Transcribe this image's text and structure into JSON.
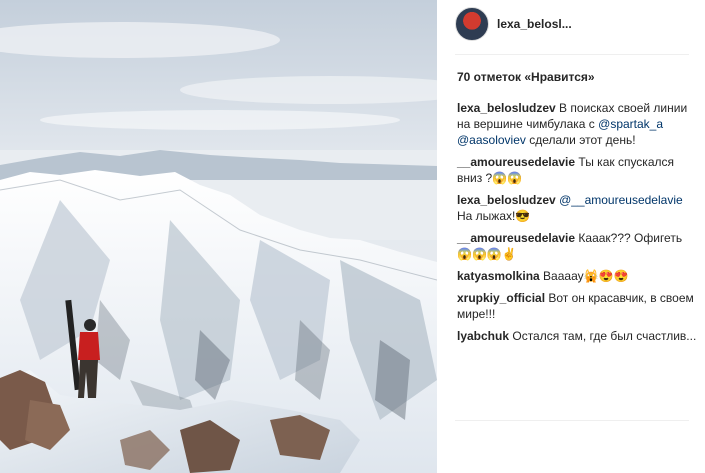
{
  "post": {
    "author": "lexa_belosl...",
    "likes_text": "70 отметок «Нравится»"
  },
  "comments": [
    {
      "user": "lexa_belosludzev",
      "parts": [
        {
          "t": " В поисках своей линии на вершине чимбулака с "
        },
        {
          "m": "@spartak_a"
        },
        {
          "t": " "
        },
        {
          "m": "@aasoloviev"
        },
        {
          "t": " сделали этот день!"
        }
      ]
    },
    {
      "user": "__amoureusedelavie",
      "parts": [
        {
          "t": " Ты как спускался вниз ?"
        }
      ],
      "emoji": "😱😱"
    },
    {
      "user": "lexa_belosludzev",
      "parts": [
        {
          "t": " "
        },
        {
          "m": "@__amoureusedelavie"
        },
        {
          "t": " На лыжах!"
        }
      ],
      "emoji": "😎"
    },
    {
      "user": "__amoureusedelavie",
      "parts": [
        {
          "t": " Кааак??? Офигеть "
        }
      ],
      "emoji": "😱😱😱✌"
    },
    {
      "user": "katyasmolkina",
      "parts": [
        {
          "t": " Ваааау"
        }
      ],
      "emoji": "🙀😍😍"
    },
    {
      "user": "xrupkiy_official",
      "parts": [
        {
          "t": " Вот он красавчик, в своем мире!!!"
        }
      ]
    },
    {
      "user": "lyabchuk",
      "parts": [
        {
          "t": " Остался там, где был счастлив..."
        }
      ]
    }
  ],
  "icons": {
    "avatar": "profile-avatar"
  },
  "colors": {
    "mention": "#003569",
    "text": "#262626",
    "divider": "#efefef"
  }
}
